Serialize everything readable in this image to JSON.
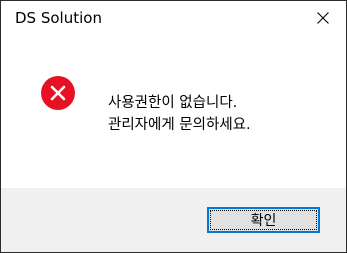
{
  "window": {
    "title": "DS Solution",
    "close_icon": "close-icon"
  },
  "message": {
    "icon": "error-icon",
    "icon_color": "#e81123",
    "lines": [
      "사용권한이 없습니다.",
      "관리자에게 문의하세요."
    ]
  },
  "buttons": {
    "ok_label": "확인"
  },
  "colors": {
    "footer_background": "#f0f0f0",
    "button_focus_border": "#0078d7"
  }
}
